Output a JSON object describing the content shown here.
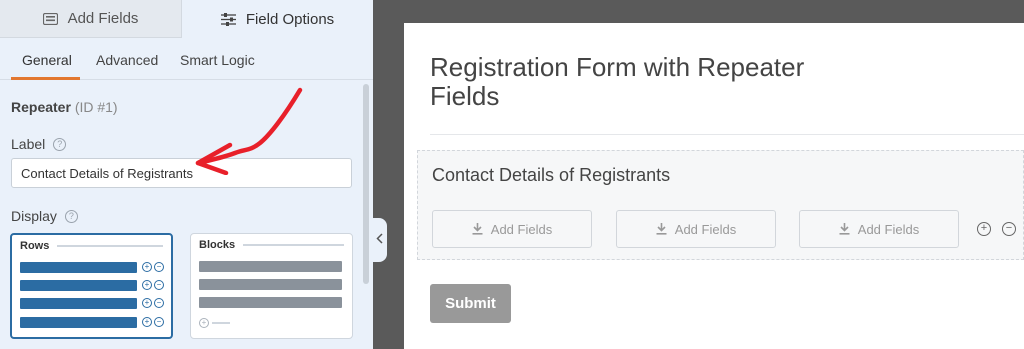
{
  "top_tabs": {
    "add_fields": "Add Fields",
    "field_options": "Field Options"
  },
  "sub_tabs": [
    "General",
    "Advanced",
    "Smart Logic"
  ],
  "field": {
    "type": "Repeater",
    "id": "(ID #1)"
  },
  "label_field": {
    "label": "Label",
    "value": "Contact Details of Registrants"
  },
  "display": {
    "label": "Display",
    "options": [
      "Rows",
      "Blocks"
    ],
    "selected": "Rows"
  },
  "preview": {
    "form_title": "Registration Form with Repeater Fields",
    "repeater_label": "Contact Details of Registrants",
    "add_field_labels": [
      "Add Fields",
      "Add Fields",
      "Add Fields"
    ],
    "submit": "Submit"
  },
  "colors": {
    "accent_orange": "#e27730",
    "selected_blue": "#2b6ca3",
    "arrow_red": "#e8202a"
  }
}
